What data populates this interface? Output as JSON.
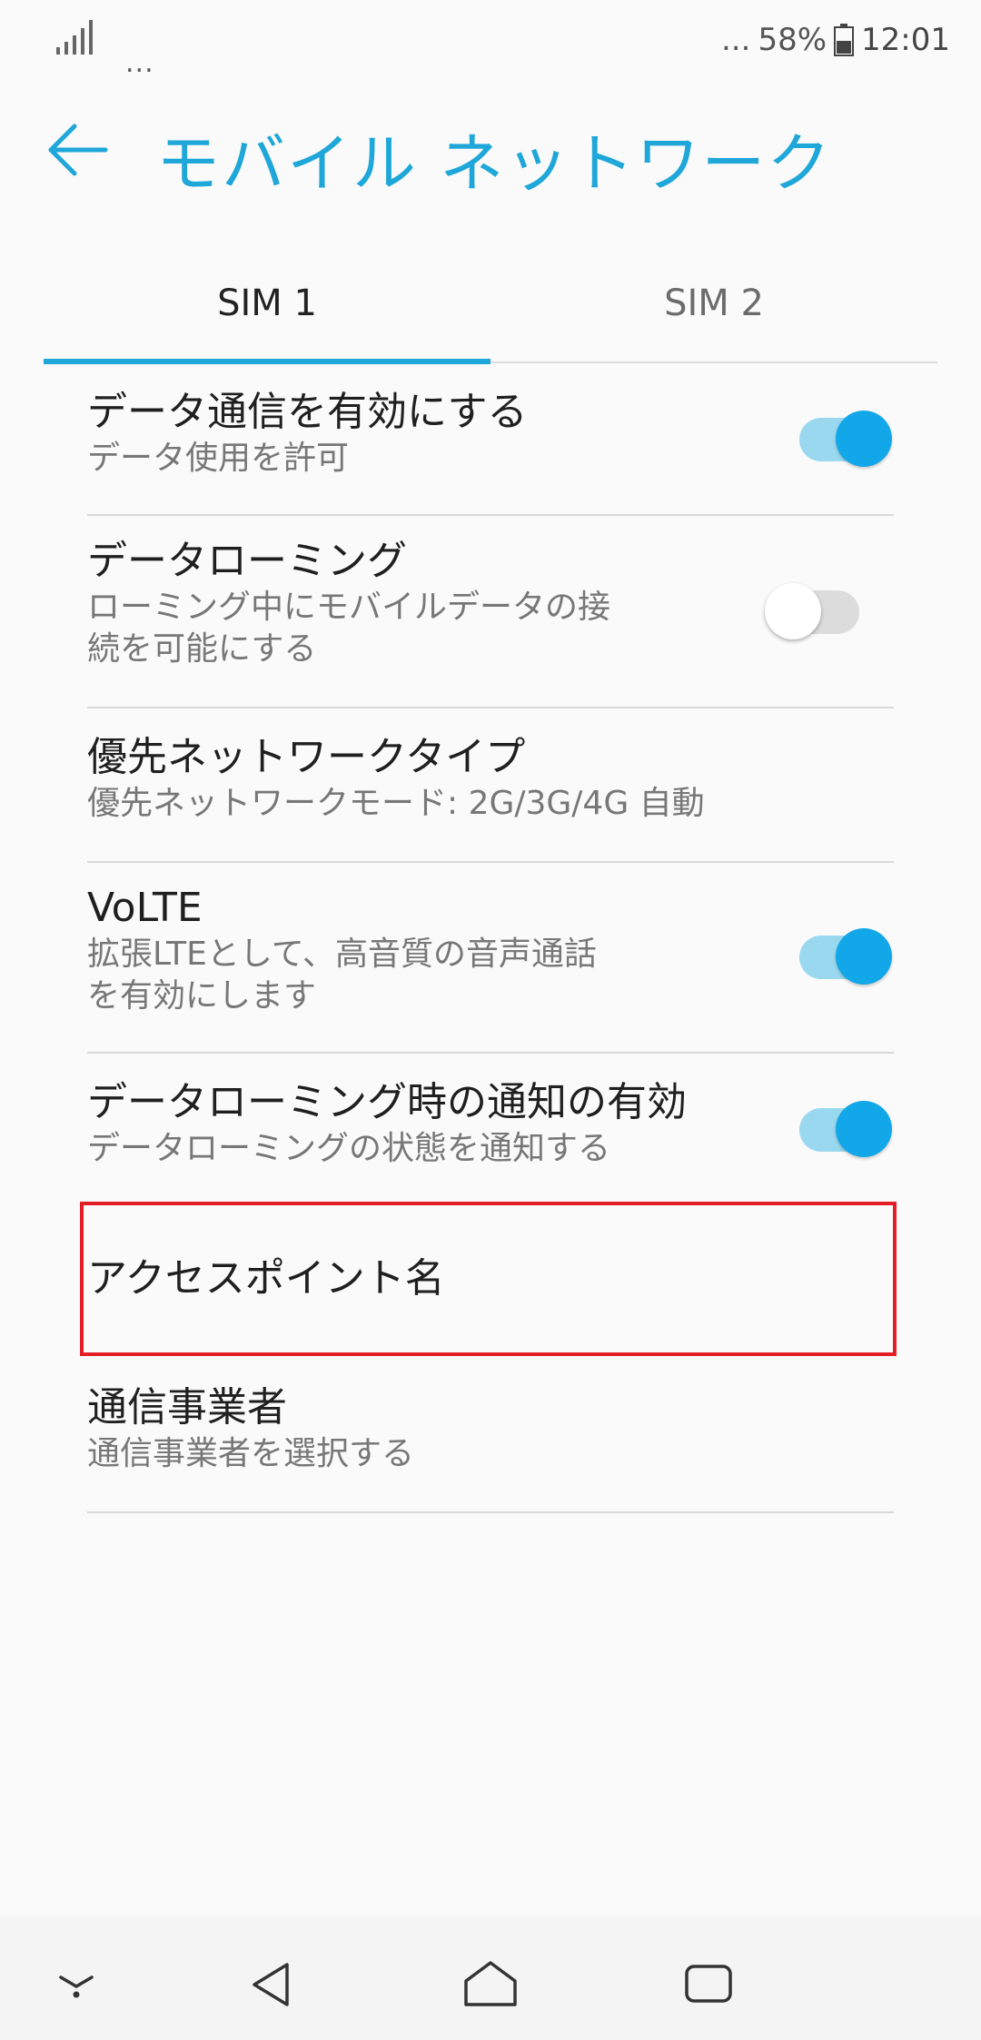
{
  "status_bar": {
    "signal_dots": "...",
    "notification_dots": "...",
    "battery_percent": "58%",
    "time": "12:01"
  },
  "app_bar": {
    "title": "モバイル ネットワーク",
    "back_icon": "arrow-left-icon"
  },
  "tabs": [
    {
      "label": "SIM 1",
      "selected": true
    },
    {
      "label": "SIM 2",
      "selected": false
    }
  ],
  "settings": [
    {
      "title": "データ通信を有効にする",
      "summary": "データ使用を許可",
      "toggle": "on"
    },
    {
      "title": "データローミング",
      "summary": "ローミング中にモバイルデータの接\n続を可能にする",
      "toggle": "off"
    },
    {
      "title": "優先ネットワークタイプ",
      "summary": "優先ネットワークモード: 2G/3G/4G 自動"
    },
    {
      "title": "VoLTE",
      "summary": "拡張LTEとして、高音質の音声通話\nを有効にします",
      "toggle": "on"
    },
    {
      "title": "データローミング時の通知の有効",
      "summary": "データローミングの状態を通知する",
      "toggle": "on"
    },
    {
      "title": "アクセスポイント名"
    },
    {
      "title": "通信事業者",
      "summary": "通信事業者を選択する"
    }
  ],
  "nav_bar": {
    "icons": [
      "chevron-down-icon",
      "back-triangle-icon",
      "home-icon",
      "recents-icon"
    ]
  },
  "colors": {
    "accent": "#1ea7d8",
    "toggle_on": "#12a7e8",
    "highlight": "#e41e26"
  }
}
